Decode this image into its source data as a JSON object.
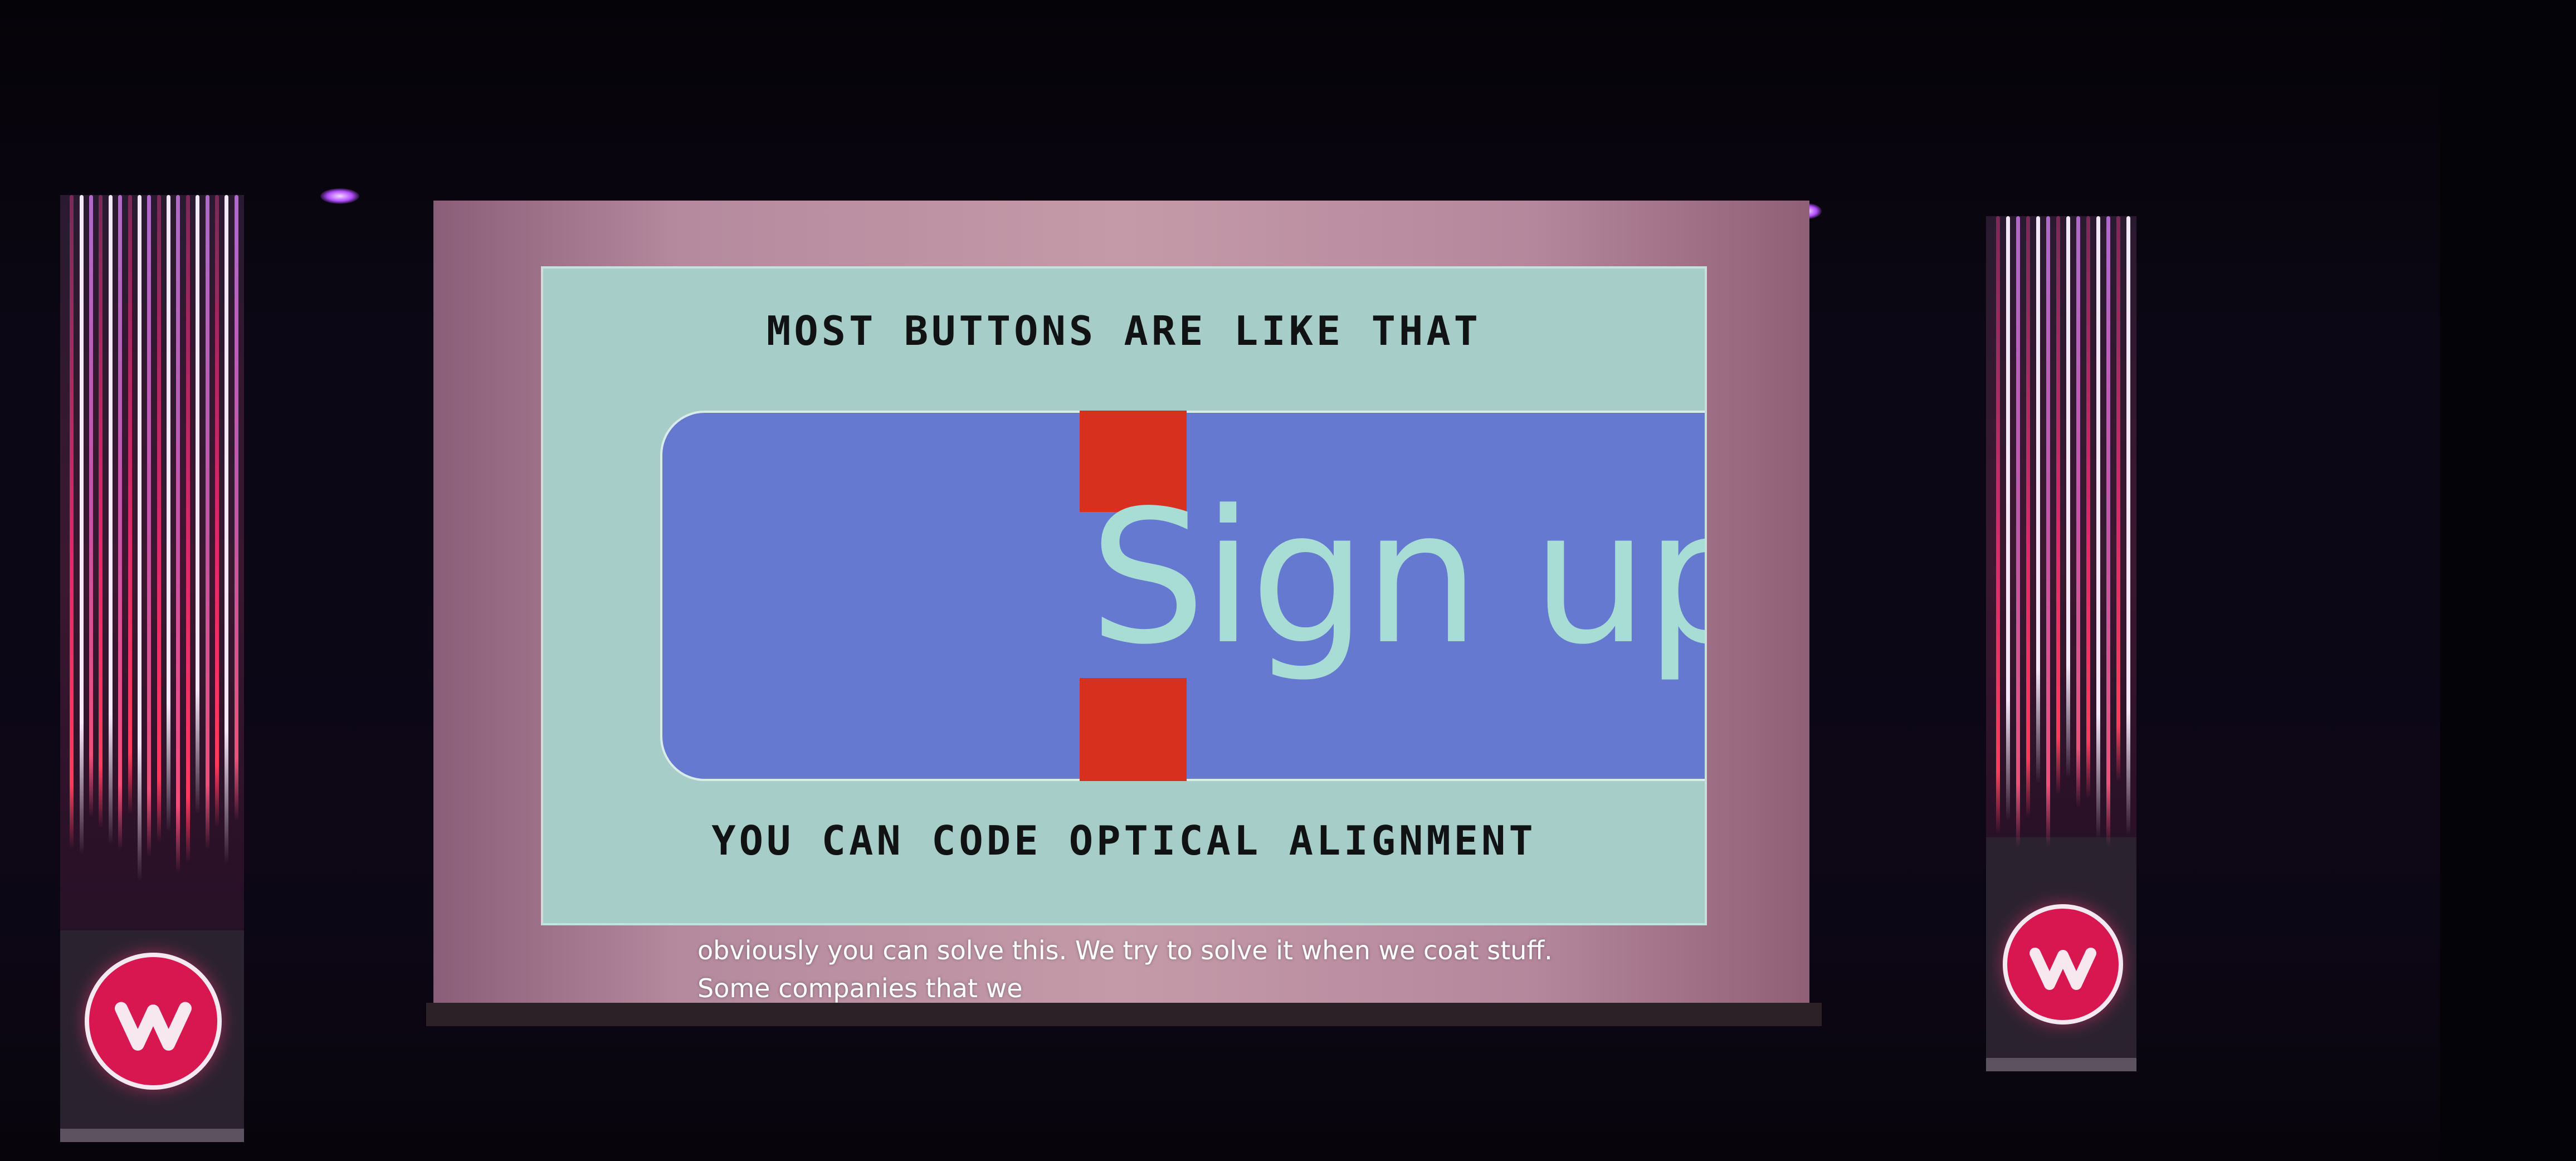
{
  "slide": {
    "heading_top": "MOST BUTTONS ARE LIKE THAT",
    "button_label": "Sign up",
    "heading_bottom": "YOU CAN CODE OPTICAL ALIGNMENT"
  },
  "captions": {
    "line1": "obviously you can solve this. We try to solve it when we coat stuff.",
    "line2": "Some companies that we"
  },
  "colors": {
    "slide_background": "#a7cdc9",
    "button_fill": "#6479cf",
    "button_text": "#a8ddd6",
    "alignment_marker": "#d8301e",
    "banner_logo": "#d8164f"
  },
  "icons": {
    "banner_logo": "w-logo-icon"
  }
}
